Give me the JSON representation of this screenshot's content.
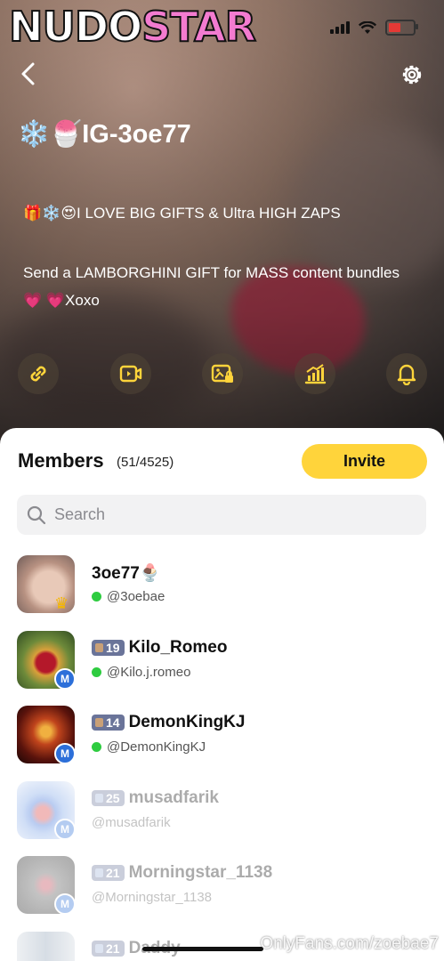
{
  "watermark_logo": {
    "part1": "NUDO",
    "part2": "STAR"
  },
  "status_bar": {
    "signal_bars": 4,
    "battery_level": 0.15
  },
  "header": {
    "back_icon": "chevron-left-icon",
    "settings_icon": "gear-icon"
  },
  "profile": {
    "title": "❄️🍧IG-3oe77",
    "description_line1": "🎁❄️😍I LOVE BIG GIFTS & Ultra HIGH ZAPS",
    "description_line2": "Send a LAMBORGHINI GIFT for MASS content bundles 💗 💗Xoxo"
  },
  "action_icons": [
    "link-icon",
    "video-icon",
    "locked-image-icon",
    "stats-icon",
    "bell-icon"
  ],
  "members": {
    "heading": "Members",
    "count": "(51/4525)",
    "invite_label": "Invite",
    "search_placeholder": "Search",
    "list": [
      {
        "name": "3oe77🍨",
        "handle": "@3oebae",
        "level": "",
        "online": true,
        "badge": "crown",
        "active": true
      },
      {
        "name": "Kilo_Romeo",
        "handle": "@Kilo.j.romeo",
        "level": "19",
        "online": true,
        "badge": "M",
        "active": true
      },
      {
        "name": "DemonKingKJ",
        "handle": "@DemonKingKJ",
        "level": "14",
        "online": true,
        "badge": "M",
        "active": true
      },
      {
        "name": "musadfarik",
        "handle": "@musadfarik",
        "level": "25",
        "online": false,
        "badge": "M",
        "active": false
      },
      {
        "name": "Morningstar_1138",
        "handle": "@Morningstar_1138",
        "level": "21",
        "online": false,
        "badge": "M",
        "active": false
      },
      {
        "name": "Daddy",
        "handle": "",
        "level": "21",
        "online": false,
        "badge": "",
        "active": false
      }
    ]
  },
  "source_watermark": "OnlyFans.com/zoebae7"
}
